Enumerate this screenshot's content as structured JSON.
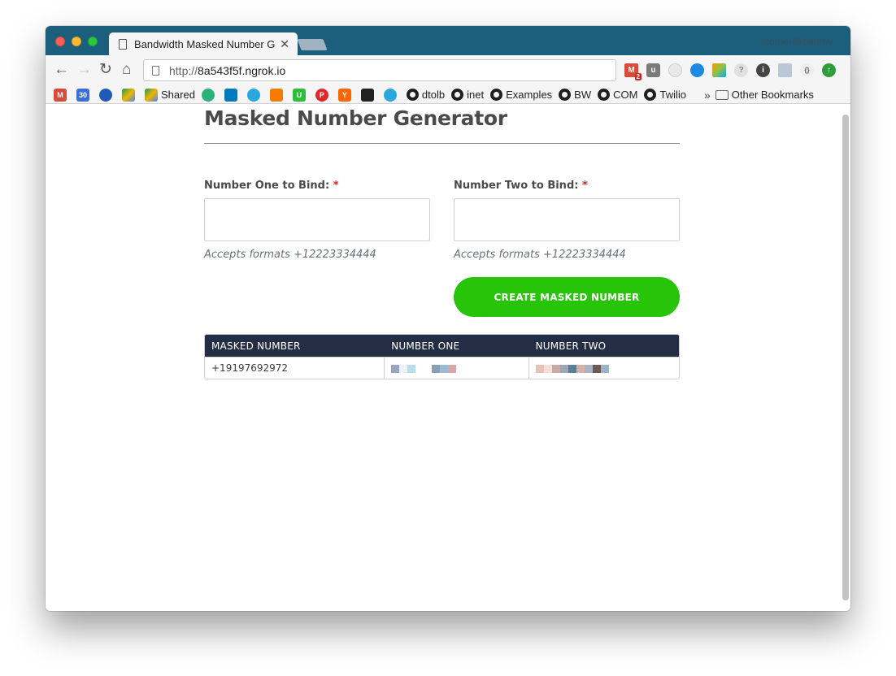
{
  "browser": {
    "tab_title": "Bandwidth Masked Number Ge",
    "tab_close": "✕",
    "profile": "dtoiber@bandw...",
    "url_scheme": "http://",
    "url_host": "8a543f5f.ngrok.io",
    "gmail_badge": "2",
    "bookmarks": {
      "shared": "Shared",
      "dtolb": "dtolb",
      "inet": "inet",
      "examples": "Examples",
      "bw": "BW",
      "com": "COM",
      "twilio": "Twilio",
      "more": "»",
      "other": "Other Bookmarks",
      "calendar_day": "30"
    }
  },
  "page": {
    "title": "Masked Number Generator",
    "field_one": {
      "label": "Number One to Bind:",
      "required": "*",
      "value": "",
      "hint": "Accepts formats +12223334444"
    },
    "field_two": {
      "label": "Number Two to Bind:",
      "required": "*",
      "value": "",
      "hint": "Accepts formats +12223334444"
    },
    "create_button": "CREATE MASKED NUMBER",
    "table": {
      "headers": [
        "MASKED NUMBER",
        "NUMBER ONE",
        "NUMBER TWO"
      ],
      "rows": [
        {
          "masked_number": "+19197692972"
        }
      ]
    }
  },
  "colors": {
    "tab_strip": "#1b5f7c",
    "create_button": "#27c40a",
    "table_header": "#232e45",
    "required": "#e02020"
  }
}
